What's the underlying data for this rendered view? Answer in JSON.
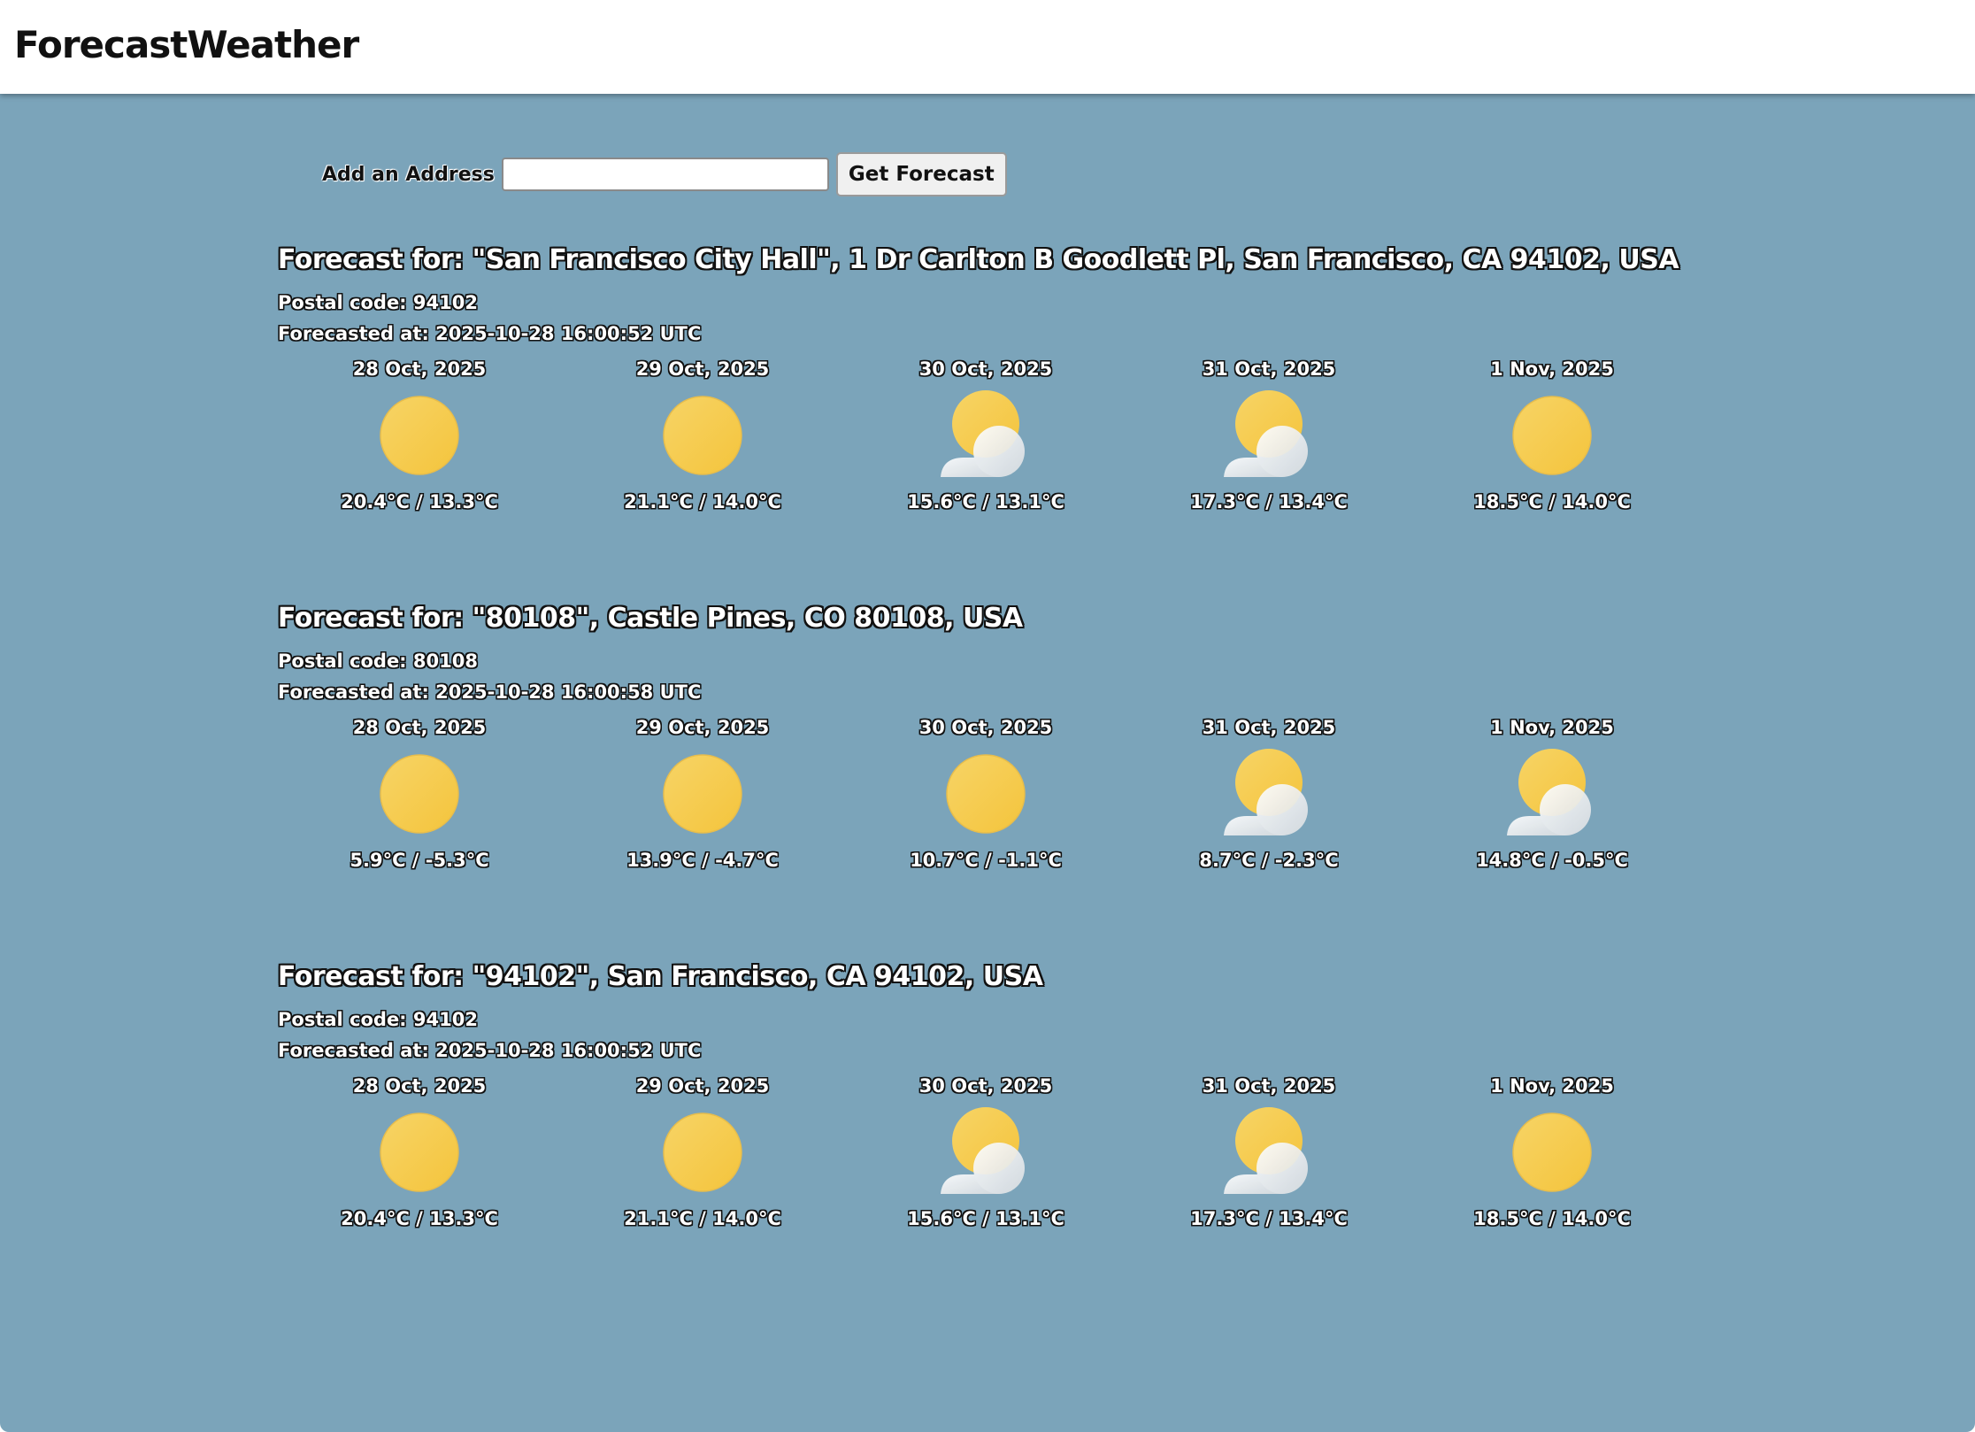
{
  "header": {
    "brand": "ForecastWeather"
  },
  "search": {
    "label": "Add an Address",
    "value": "",
    "placeholder": "",
    "button_label": "Get Forecast"
  },
  "colors": {
    "background": "#7ba4ba",
    "sun": "#f4c43c",
    "cloud": "#eef0f2"
  },
  "forecasts": [
    {
      "title": "Forecast for: \"San Francisco City Hall\", 1 Dr Carlton B Goodlett Pl, San Francisco, CA 94102, USA",
      "postal": "Postal code: 94102",
      "forecasted_at": "Forecasted at: 2025-10-28 16:00:52 UTC",
      "days": [
        {
          "date": "28 Oct, 2025",
          "icon": "sun-icon",
          "temp": "20.4°C / 13.3°C"
        },
        {
          "date": "29 Oct, 2025",
          "icon": "sun-icon",
          "temp": "21.1°C / 14.0°C"
        },
        {
          "date": "30 Oct, 2025",
          "icon": "partly-cloudy-icon",
          "temp": "15.6°C / 13.1°C"
        },
        {
          "date": "31 Oct, 2025",
          "icon": "partly-cloudy-icon",
          "temp": "17.3°C / 13.4°C"
        },
        {
          "date": "1 Nov, 2025",
          "icon": "sun-icon",
          "temp": "18.5°C / 14.0°C"
        }
      ]
    },
    {
      "title": "Forecast for: \"80108\", Castle Pines, CO 80108, USA",
      "postal": "Postal code: 80108",
      "forecasted_at": "Forecasted at: 2025-10-28 16:00:58 UTC",
      "days": [
        {
          "date": "28 Oct, 2025",
          "icon": "sun-icon",
          "temp": "5.9°C / -5.3°C"
        },
        {
          "date": "29 Oct, 2025",
          "icon": "sun-icon",
          "temp": "13.9°C / -4.7°C"
        },
        {
          "date": "30 Oct, 2025",
          "icon": "sun-icon",
          "temp": "10.7°C / -1.1°C"
        },
        {
          "date": "31 Oct, 2025",
          "icon": "partly-cloudy-icon",
          "temp": "8.7°C / -2.3°C"
        },
        {
          "date": "1 Nov, 2025",
          "icon": "partly-cloudy-icon",
          "temp": "14.8°C / -0.5°C"
        }
      ]
    },
    {
      "title": "Forecast for: \"94102\", San Francisco, CA 94102, USA",
      "postal": "Postal code: 94102",
      "forecasted_at": "Forecasted at: 2025-10-28 16:00:52 UTC",
      "days": [
        {
          "date": "28 Oct, 2025",
          "icon": "sun-icon",
          "temp": "20.4°C / 13.3°C"
        },
        {
          "date": "29 Oct, 2025",
          "icon": "sun-icon",
          "temp": "21.1°C / 14.0°C"
        },
        {
          "date": "30 Oct, 2025",
          "icon": "partly-cloudy-icon",
          "temp": "15.6°C / 13.1°C"
        },
        {
          "date": "31 Oct, 2025",
          "icon": "partly-cloudy-icon",
          "temp": "17.3°C / 13.4°C"
        },
        {
          "date": "1 Nov, 2025",
          "icon": "sun-icon",
          "temp": "18.5°C / 14.0°C"
        }
      ]
    }
  ]
}
